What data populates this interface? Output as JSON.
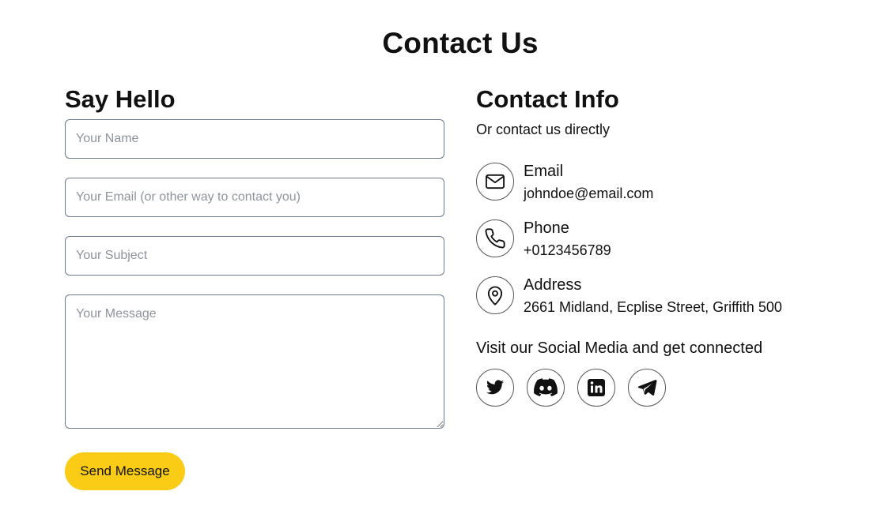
{
  "page": {
    "title": "Contact Us"
  },
  "form": {
    "heading": "Say Hello",
    "name_placeholder": "Your Name",
    "email_placeholder": "Your Email (or other way to contact you)",
    "subject_placeholder": "Your Subject",
    "message_placeholder": "Your Message",
    "submit_label": "Send Message",
    "accent_color": "#facc15"
  },
  "contact": {
    "heading": "Contact Info",
    "subtitle": "Or contact us directly",
    "items": [
      {
        "icon": "envelope-icon",
        "label": "Email",
        "value": "johndoe@email.com"
      },
      {
        "icon": "phone-icon",
        "label": "Phone",
        "value": "+0123456789"
      },
      {
        "icon": "location-pin-icon",
        "label": "Address",
        "value": "2661 Midland, Ecplise Street, Griffith 500"
      }
    ]
  },
  "social": {
    "heading": "Visit our Social Media and get connected",
    "links": [
      {
        "icon": "twitter-icon"
      },
      {
        "icon": "discord-icon"
      },
      {
        "icon": "linkedin-icon"
      },
      {
        "icon": "telegram-icon"
      }
    ]
  }
}
